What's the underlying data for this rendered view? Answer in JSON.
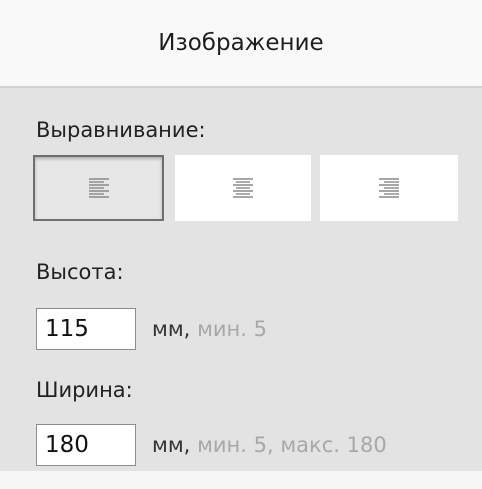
{
  "header": {
    "title": "Изображение"
  },
  "alignment": {
    "label": "Выравнивание:",
    "options": [
      {
        "name": "align-left",
        "selected": true
      },
      {
        "name": "align-center",
        "selected": false
      },
      {
        "name": "align-right",
        "selected": false
      }
    ]
  },
  "height": {
    "label": "Высота:",
    "value": "115",
    "unit": "мм,",
    "constraint": "мин. 5"
  },
  "width": {
    "label": "Ширина:",
    "value": "180",
    "unit": "мм,",
    "constraint": "мин. 5, макс. 180"
  },
  "colors": {
    "panel_background": "#e3e3e3",
    "header_background": "#f9f9f9",
    "muted_text": "#a8a8a8",
    "selected_border": "#6f6f6f"
  }
}
